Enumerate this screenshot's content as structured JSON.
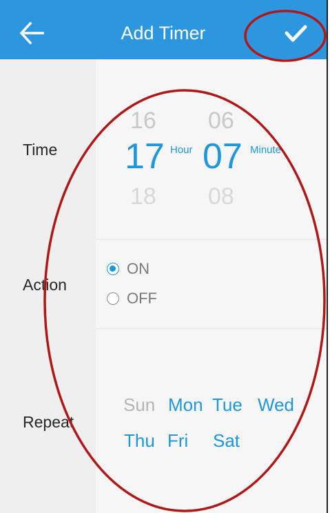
{
  "header": {
    "title": "Add Timer",
    "back_icon": "arrow-left-icon",
    "confirm_icon": "checkmark-icon",
    "background": "#2c97df"
  },
  "time": {
    "label": "Time",
    "hour_prev": "16",
    "hour": "17",
    "hour_next": "18",
    "hour_unit": "Hour",
    "minute_prev": "06",
    "minute": "07",
    "minute_next": "08",
    "minute_unit": "Minute"
  },
  "action": {
    "label": "Action",
    "options": [
      {
        "label": "ON",
        "checked": true
      },
      {
        "label": "OFF",
        "checked": false
      }
    ]
  },
  "repeat": {
    "label": "Repeat",
    "days": [
      {
        "label": "Sun",
        "selected": false
      },
      {
        "label": "Mon",
        "selected": true
      },
      {
        "label": "Tue",
        "selected": true
      },
      {
        "label": "Wed",
        "selected": true
      },
      {
        "label": "Thu",
        "selected": true
      },
      {
        "label": "Fri",
        "selected": true
      },
      {
        "label": "Sat",
        "selected": true
      }
    ]
  },
  "colors": {
    "accent": "#1f97dc",
    "annotation": "#b01818"
  }
}
